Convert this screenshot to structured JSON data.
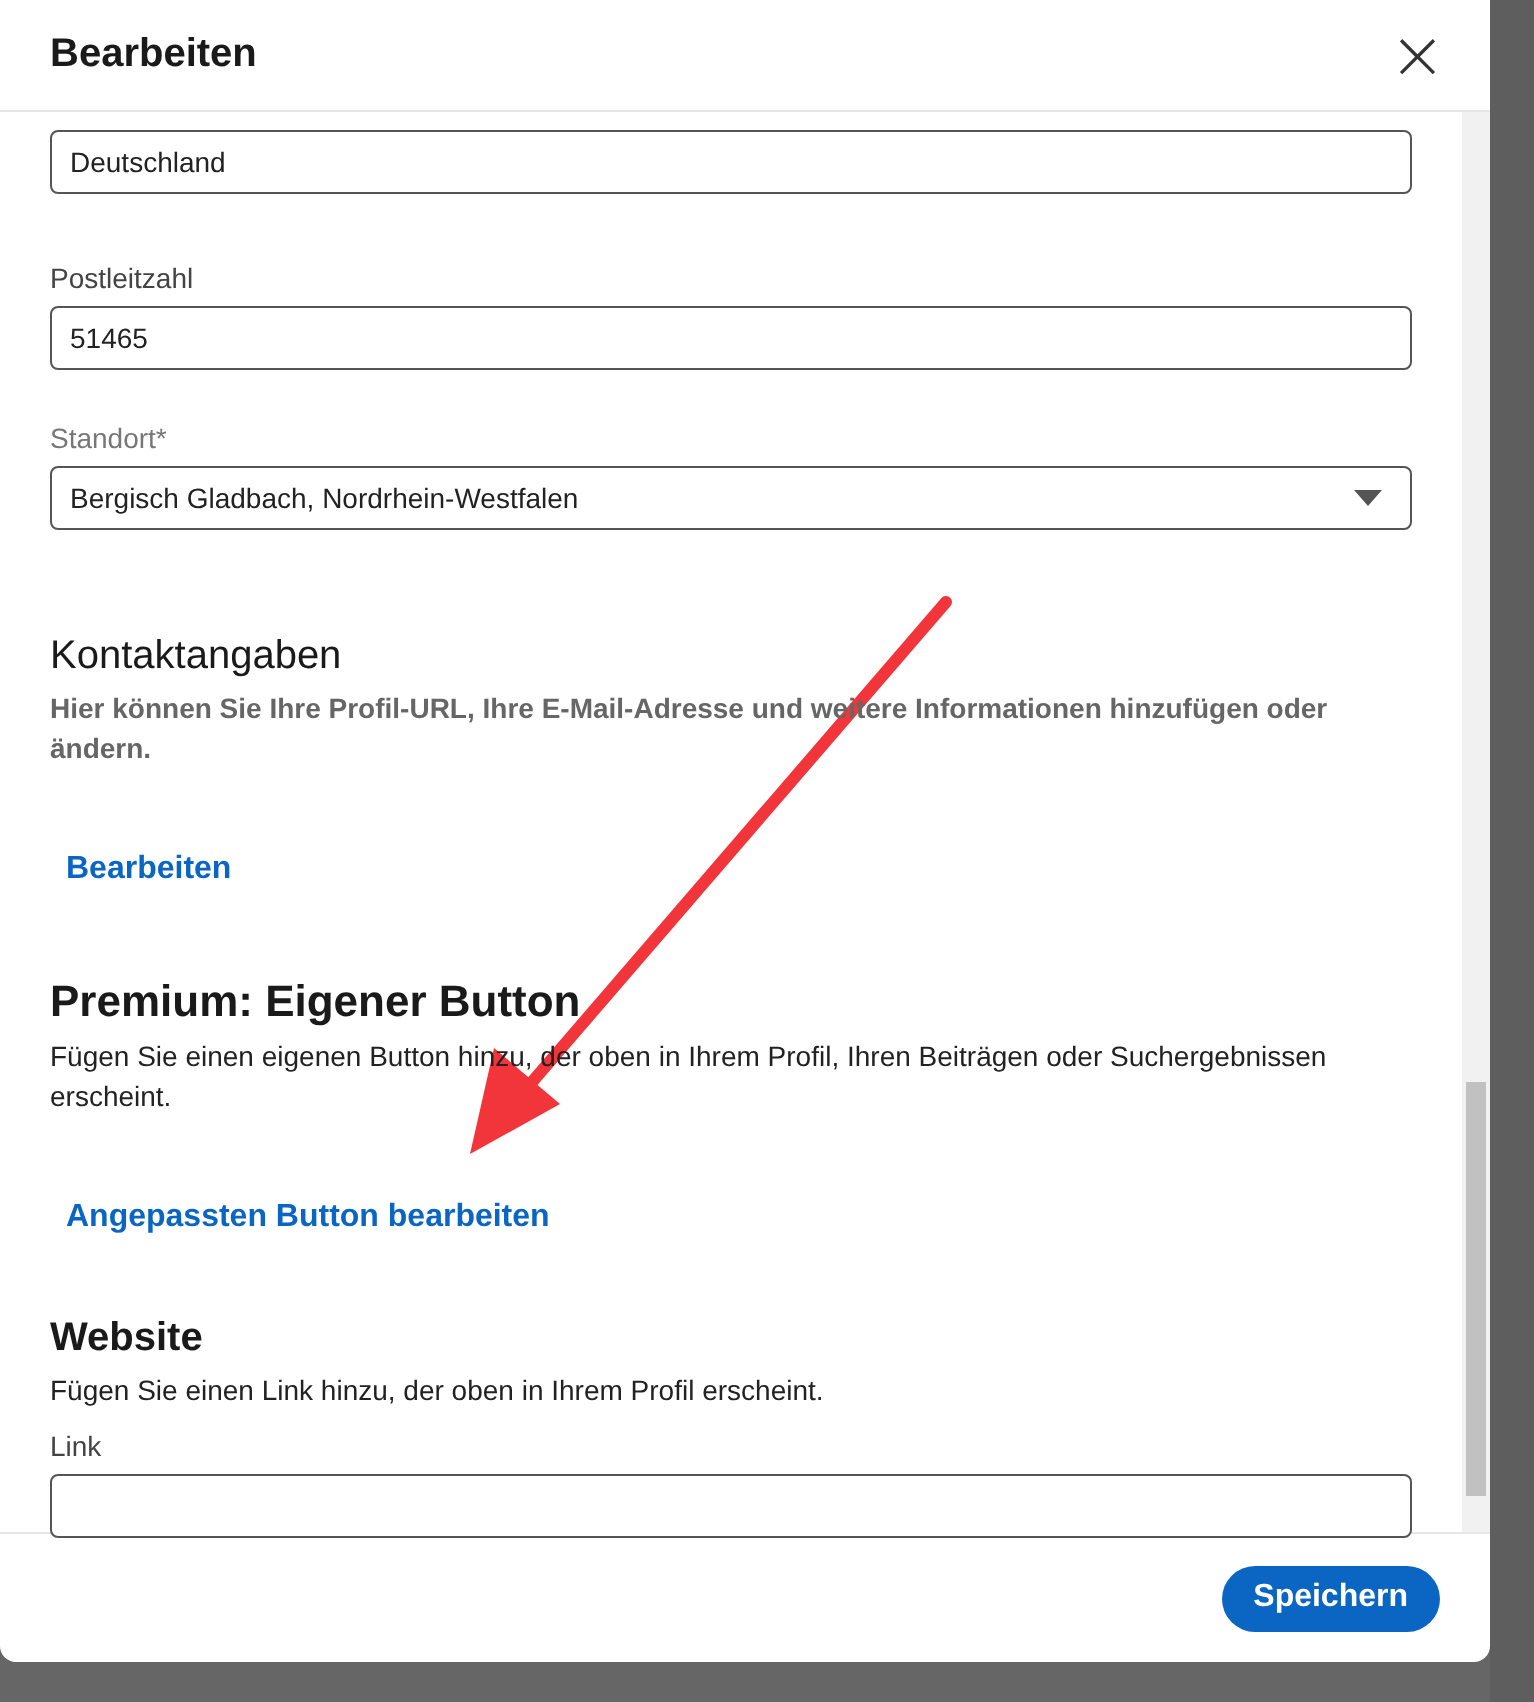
{
  "dialog": {
    "title": "Bearbeiten",
    "close": "×"
  },
  "fields": [
    {
      "value": "Deutschland",
      "kind": "text"
    },
    {
      "label": "Postleitzahl",
      "value": "51465",
      "kind": "text"
    },
    {
      "label": "Standort*",
      "value": "Bergisch Gladbach, Nordrhein-Westfalen",
      "kind": "select"
    }
  ],
  "sections": [
    {
      "title": "Kontaktangaben",
      "kind": "light",
      "text": "Hier können Sie Ihre Profil-URL, Ihre E-Mail-Adresse und weitere Informationen hinzufügen oder ändern.",
      "link": "Bearbeiten"
    },
    {
      "title": "Premium: Eigener Button",
      "kind": "large",
      "text": "Fügen Sie einen eigenen Button hinzu, der oben in Ihrem Profil, Ihren Beiträgen oder Suchergebnissen erscheint.",
      "link": "Angepassten Button bearbeiten"
    }
  ],
  "website": {
    "title": "Website",
    "text": "Fügen Sie einen Link hinzu, der oben in Ihrem Profil erscheint.",
    "label": "Link"
  },
  "footer": {
    "save": "Speichern"
  }
}
